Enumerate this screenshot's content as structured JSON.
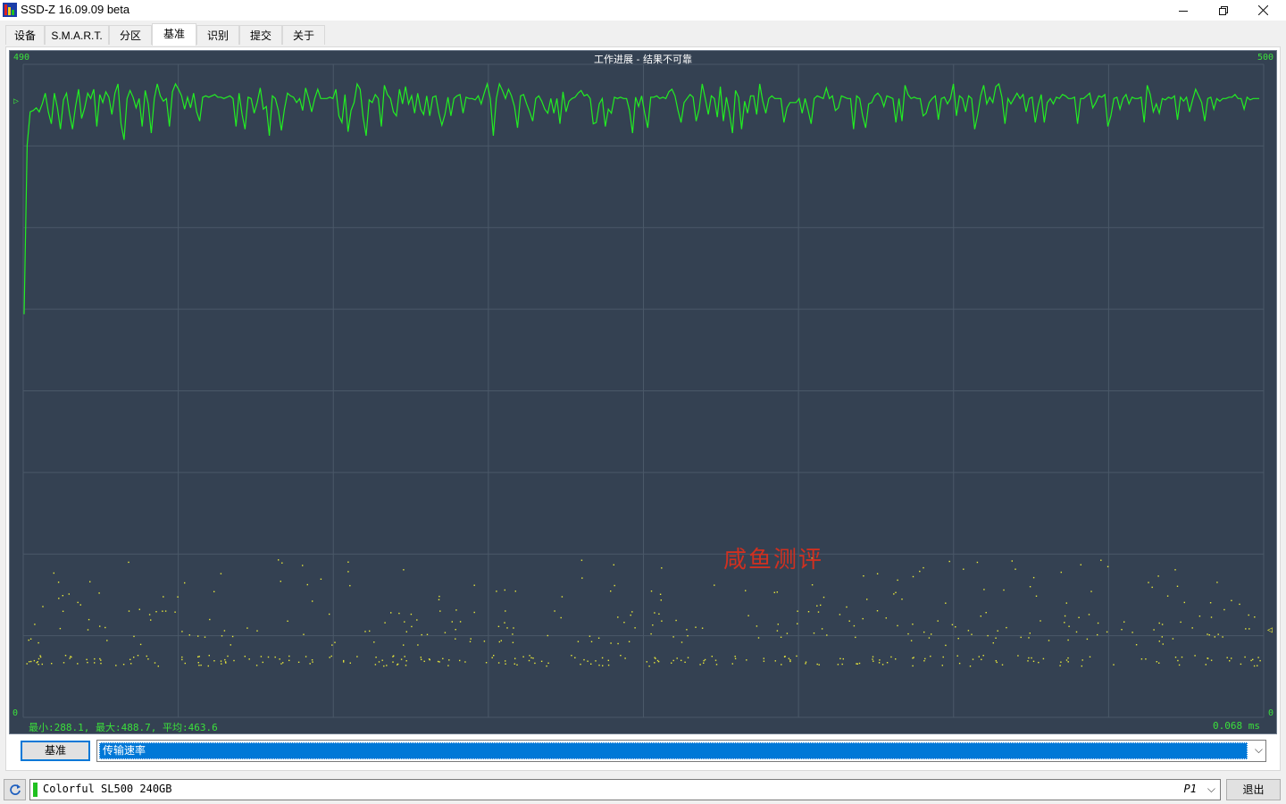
{
  "window": {
    "title": "SSD-Z 16.09.09 beta"
  },
  "tabs": [
    {
      "label": "设备"
    },
    {
      "label": "S.M.A.R.T."
    },
    {
      "label": "分区"
    },
    {
      "label": "基准"
    },
    {
      "label": "识别"
    },
    {
      "label": "提交"
    },
    {
      "label": "关于"
    }
  ],
  "graph": {
    "title": "工作进展 - 结果不可靠",
    "y_max_left": "490",
    "y_max_right": "500",
    "y_min_left": "0",
    "y_min_right": "0",
    "stats": "最小:288.1, 最大:488.7, 平均:463.6",
    "latency": "0.068 ms",
    "watermark": "咸鱼测评"
  },
  "controls": {
    "bench_button": "基准",
    "metric_selected": "传输速率"
  },
  "status": {
    "drive_name": "Colorful SL500 240GB",
    "port": "P1",
    "exit_label": "退出"
  },
  "colors": {
    "graph_bg": "#344152",
    "line": "#22ee22",
    "dots": "#e8e83a",
    "watermark": "#d03020"
  },
  "chart_data": {
    "type": "line",
    "title": "工作进展 - 结果不可靠",
    "ylim": [
      0,
      500
    ],
    "xlabel": "",
    "ylabel": "",
    "series": [
      {
        "values": [
          297,
          424,
          449,
          450,
          452,
          449,
          455,
          463,
          449,
          440,
          463,
          452,
          436,
          458,
          463,
          448,
          436,
          453,
          466,
          444,
          452,
          463,
          459,
          466,
          438,
          462,
          456,
          464,
          460,
          447,
          463,
          470,
          440,
          428,
          459,
          465,
          460,
          452,
          459,
          438,
          465,
          455,
          433,
          459,
          470,
          461,
          457,
          459,
          438,
          464,
          470,
          466,
          461,
          451,
          460,
          452,
          463,
          449,
          442,
          460,
          461,
          460,
          461,
          462,
          460,
          460,
          459,
          460,
          461,
          459,
          438,
          463,
          447,
          436,
          460,
          459,
          448,
          456,
          467,
          451,
          453,
          431,
          461,
          459,
          450,
          435,
          451,
          463,
          461,
          460,
          456,
          459,
          450,
          467,
          459,
          449,
          459,
          466,
          459,
          459,
          459,
          460,
          459,
          466,
          446,
          441,
          462,
          434,
          450,
          456,
          470,
          466,
          445,
          431,
          458,
          456,
          462,
          459,
          438,
          469,
          462,
          459,
          449,
          446,
          466,
          455,
          468,
          455,
          461,
          448,
          463,
          451,
          447,
          461,
          446,
          460,
          461,
          448,
          439,
          447,
          460,
          446,
          459,
          461,
          462,
          448,
          460,
          459,
          459,
          458,
          461,
          455,
          463,
          470,
          459,
          431,
          459,
          470,
          465,
          459,
          466,
          461,
          453,
          437,
          461,
          462,
          455,
          449,
          442,
          459,
          461,
          457,
          451,
          448,
          459,
          448,
          459,
          440,
          464,
          449,
          457,
          459,
          460,
          463,
          465,
          461,
          462,
          459,
          440,
          441,
          455,
          459,
          438,
          451,
          448,
          460,
          459,
          460,
          459,
          459,
          450,
          433,
          460,
          453,
          461,
          448,
          437,
          460,
          460,
          461,
          459,
          460,
          459,
          464,
          466,
          461,
          450,
          441,
          456,
          459,
          462,
          460,
          442,
          451,
          470,
          459,
          447,
          461,
          459,
          445,
          468,
          442,
          460,
          448,
          433,
          465,
          460,
          436,
          457,
          448,
          461,
          461,
          447,
          470,
          457,
          448,
          459,
          461,
          459,
          459,
          459,
          441,
          452,
          456,
          456,
          456,
          459,
          448,
          459,
          450,
          440,
          459,
          461,
          460,
          459,
          467,
          459,
          461,
          450,
          452,
          461,
          460,
          459,
          459,
          436,
          461,
          459,
          446,
          437,
          455,
          456,
          461,
          463,
          460,
          453,
          461,
          460,
          459,
          441,
          459,
          442,
          469,
          462,
          459,
          460,
          459,
          459,
          446,
          448,
          456,
          459,
          461,
          443,
          459,
          460,
          455,
          459,
          470,
          446,
          461,
          459,
          449,
          461,
          459,
          436,
          447,
          461,
          469,
          455,
          460,
          456,
          468,
          470,
          460,
          440,
          459,
          455,
          459,
          463,
          459,
          462,
          449,
          459,
          460,
          441,
          454,
          462,
          441,
          456,
          459,
          455,
          460,
          459,
          462,
          461,
          459,
          459,
          460,
          440,
          459,
          459,
          461,
          463,
          452,
          456,
          461,
          460,
          462,
          438,
          446,
          459,
          460,
          451,
          459,
          462,
          455,
          460,
          459,
          459,
          460,
          441,
          469,
          462,
          449,
          455,
          448,
          459,
          458,
          460,
          459,
          461,
          443,
          460,
          457,
          460,
          449,
          458,
          466,
          461,
          456,
          442,
          459,
          460,
          451,
          459,
          457,
          459,
          459,
          460,
          460,
          462,
          459,
          459,
          451,
          460,
          458,
          459,
          459,
          459
        ]
      }
    ]
  }
}
